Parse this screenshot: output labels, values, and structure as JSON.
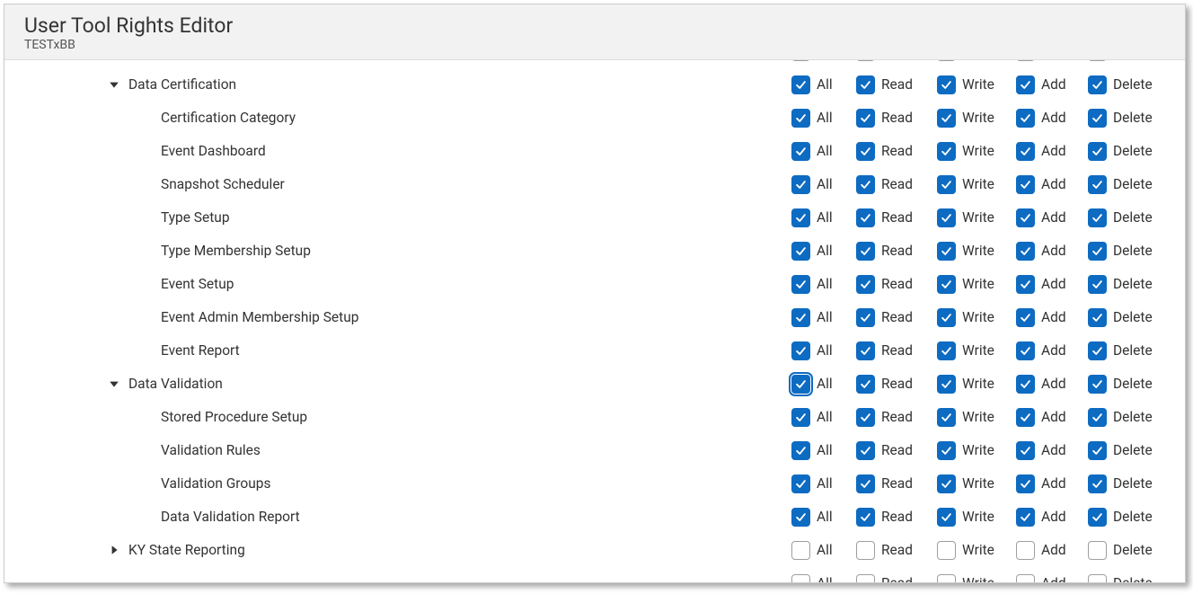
{
  "header": {
    "title": "User Tool Rights Editor",
    "subtitle": "TESTxBB"
  },
  "columns": {
    "all": "All",
    "read": "Read",
    "write": "Write",
    "add": "Add",
    "delete": "Delete"
  },
  "rows": [
    {
      "label": "",
      "indent": 2,
      "expand": "none",
      "checked": false,
      "focus": false,
      "cut": "top"
    },
    {
      "label": "Data Certification",
      "indent": 1,
      "expand": "expanded",
      "checked": true,
      "focus": false
    },
    {
      "label": "Certification Category",
      "indent": 2,
      "expand": "none",
      "checked": true,
      "focus": false
    },
    {
      "label": "Event Dashboard",
      "indent": 2,
      "expand": "none",
      "checked": true,
      "focus": false
    },
    {
      "label": "Snapshot Scheduler",
      "indent": 2,
      "expand": "none",
      "checked": true,
      "focus": false
    },
    {
      "label": "Type Setup",
      "indent": 2,
      "expand": "none",
      "checked": true,
      "focus": false
    },
    {
      "label": "Type Membership Setup",
      "indent": 2,
      "expand": "none",
      "checked": true,
      "focus": false
    },
    {
      "label": "Event Setup",
      "indent": 2,
      "expand": "none",
      "checked": true,
      "focus": false
    },
    {
      "label": "Event Admin Membership Setup",
      "indent": 2,
      "expand": "none",
      "checked": true,
      "focus": false
    },
    {
      "label": "Event Report",
      "indent": 2,
      "expand": "none",
      "checked": true,
      "focus": false
    },
    {
      "label": "Data Validation",
      "indent": 1,
      "expand": "expanded",
      "checked": true,
      "focus": true
    },
    {
      "label": "Stored Procedure Setup",
      "indent": 2,
      "expand": "none",
      "checked": true,
      "focus": false
    },
    {
      "label": "Validation Rules",
      "indent": 2,
      "expand": "none",
      "checked": true,
      "focus": false
    },
    {
      "label": "Validation Groups",
      "indent": 2,
      "expand": "none",
      "checked": true,
      "focus": false
    },
    {
      "label": "Data Validation Report",
      "indent": 2,
      "expand": "none",
      "checked": true,
      "focus": false
    },
    {
      "label": "KY State Reporting",
      "indent": 1,
      "expand": "collapsed",
      "checked": false,
      "focus": false
    },
    {
      "label": "",
      "indent": 0,
      "expand": "none",
      "checked": false,
      "focus": false,
      "cut": "bottom"
    }
  ]
}
